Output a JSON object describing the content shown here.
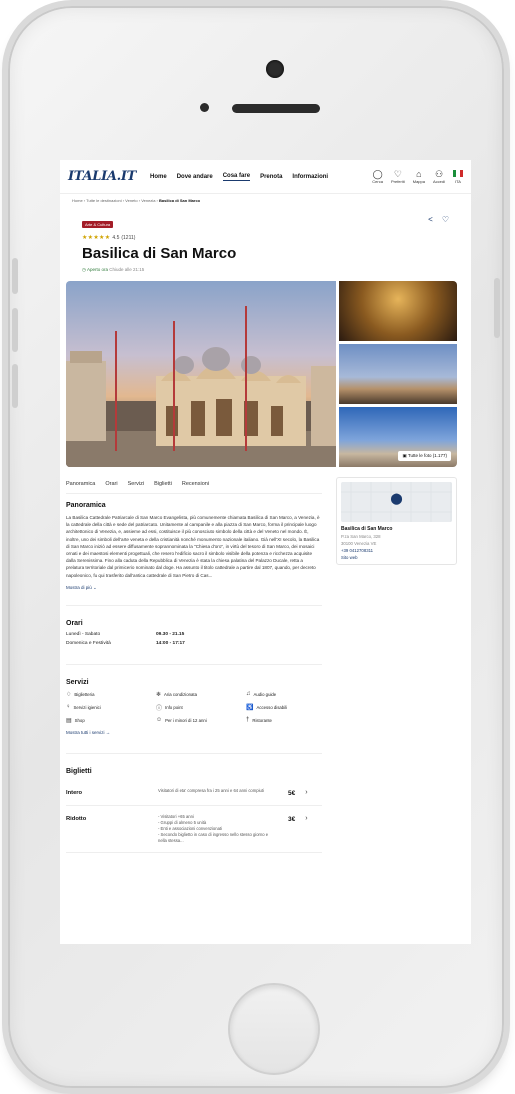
{
  "header": {
    "logo": "ITALIA.IT",
    "nav": [
      "Home",
      "Dove andare",
      "Cosa fare",
      "Prenota",
      "Informazioni"
    ],
    "actions": [
      {
        "label": "Cerca",
        "icon": "search-icon",
        "glyph": "◯"
      },
      {
        "label": "Preferiti",
        "icon": "heart-icon",
        "glyph": "♡"
      },
      {
        "label": "Mappa",
        "icon": "map-icon",
        "glyph": "⌂"
      },
      {
        "label": "Accedi",
        "icon": "user-icon",
        "glyph": "⚇"
      }
    ],
    "lang": "ITA"
  },
  "breadcrumb": {
    "items": [
      "Home",
      "Tutte le destinazioni",
      "Veneto",
      "Venezia"
    ],
    "current": "Basilica di San Marco"
  },
  "poi": {
    "badge": "Arte & Cultura",
    "stars": "★★★★★",
    "rating": "4.5",
    "reviews": "(1211)",
    "title": "Basilica di San Marco",
    "status_open": "Aperto ora",
    "status_close": "Chiude alle 21:15",
    "photos_button": "Tutte le foto (1.177)"
  },
  "tabs": [
    "Panoramica",
    "Orari",
    "Servizi",
    "Biglietti",
    "Recensioni"
  ],
  "overview": {
    "title": "Panoramica",
    "text": "La Basilica Cattedrale Patriarcale di San Marco Evangelista, più comunemente chiamata Basilica di San Marco, a Venezia, è la cattedrale della città e sede del patriarcato. Unitamente al campanile e alla piazza di San Marco, forma il principale luogo architettonico di Venezia, e, assieme ad essi, costituisce il più conosciuto simbolo della città e del Veneto nel mondo. È, inoltre, uno dei simboli dell'arte veneta e della cristianità nonché monumento nazionale italiano. Già nell'XI secolo, la Basilica di San Marco iniziò ad essere diffusamente soprannominata la \"Chiesa d'oro\", in virtù del tesoro di San Marco, dei mosaici ornati e dei maestosi elementi progettuali, che resero l'edificio sacro il simbolo visibile della potenza e ricchezza acquisite dalla Serenissima. Fino alla caduta della Repubblica di Venezia è stata la chiesa palatina del Palazzo Ducale, retta a prelatura territoriale dal primicerio nominato dal doge. Ha assunto il titolo cattedrale a partire dal 1807, quando, per decreto napoleonico, fu qui trasferito dall'antica cattedrale di San Pietro di Cas...",
    "more": "Mostra di più"
  },
  "place_card": {
    "name": "Basilica di San Marco",
    "address1": "P.za San Marco, 328",
    "address2": "30100 Venezia VE",
    "phone": "+39 0412708311",
    "website": "Sito web"
  },
  "hours": {
    "title": "Orari",
    "rows": [
      {
        "day": "Lunedì - Sabato",
        "time": "09.30 - 21.15"
      },
      {
        "day": "Domenica e Festività",
        "time": "14:00 - 17:17"
      }
    ]
  },
  "services": {
    "title": "Servizi",
    "items": [
      {
        "label": "Biglietteria",
        "icon": "ticket-icon",
        "glyph": "♢"
      },
      {
        "label": "Aria condizionata",
        "icon": "snowflake-icon",
        "glyph": "❄"
      },
      {
        "label": "Audio guide",
        "icon": "headphones-icon",
        "glyph": "♫"
      },
      {
        "label": "Servizi igienici",
        "icon": "restroom-icon",
        "glyph": "♀"
      },
      {
        "label": "Info point",
        "icon": "info-icon",
        "glyph": "ⓘ"
      },
      {
        "label": "Accesso disabili",
        "icon": "accessibility-icon",
        "glyph": "♿"
      },
      {
        "label": "Shop",
        "icon": "shop-icon",
        "glyph": "▤"
      },
      {
        "label": "Per i minori di 12 anni",
        "icon": "child-icon",
        "glyph": "☺"
      },
      {
        "label": "Ristorante",
        "icon": "restaurant-icon",
        "glyph": "†"
      }
    ],
    "more": "Mostra tutti i servizi →"
  },
  "tickets": {
    "title": "Biglietti",
    "items": [
      {
        "name": "Intero",
        "desc": "Visitatori di eta' compresa fra i 25 anni e 64 anni compiuti",
        "price": "5€"
      },
      {
        "name": "Ridotto",
        "desc": "- Visitatori +65 anni\n- Gruppi di almeno 5 unità\n- Enti e associazioni convenzionati\n- Secondo biglietto in caso di ingresso nello stesso giorno e nella stessa...",
        "price": "3€"
      }
    ]
  },
  "colors": {
    "brand": "#1a3a6e",
    "badge": "#a31d28",
    "open": "#2f7a3a",
    "flag": [
      "#1a8f3a",
      "#ffffff",
      "#cf2a2a"
    ]
  }
}
